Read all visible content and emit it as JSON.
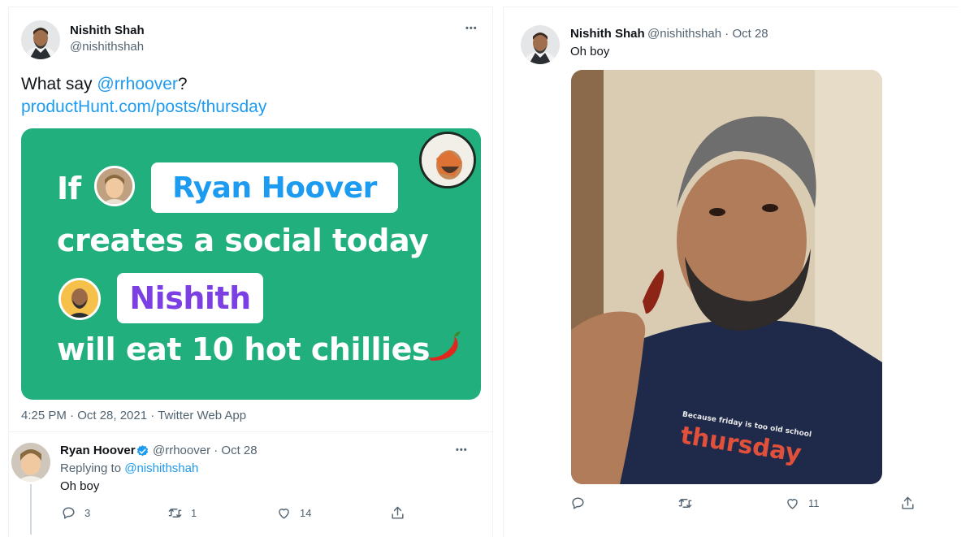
{
  "main_tweet": {
    "author_name": "Nishith Shah",
    "author_handle": "@nishithshah",
    "more": "•••",
    "text_prefix": "What say ",
    "mention": "@rrhoover",
    "text_suffix": "?",
    "link": "productHunt.com/posts/thursday",
    "card": {
      "line1_prefix": "If",
      "pill1": "Ryan Hoover",
      "line2": "creates a social today",
      "pill2": "Nishith",
      "line3": "will eat 10 hot chillies",
      "pill1_color": "#1d9bf0",
      "pill2_color": "#7b3fe4",
      "bg_color": "#21b07d"
    },
    "meta": "4:25 PM · Oct 28, 2021 · Twitter Web App"
  },
  "reply": {
    "author_name": "Ryan Hoover",
    "author_handle": "@rrhoover · Oct 28",
    "verified_icon": "verified-badge-icon",
    "replying_label": "Replying to ",
    "replying_handle": "@nishithshah",
    "text": "Oh boy",
    "more": "•••",
    "actions": {
      "reply_count": "3",
      "retweet_count": "1",
      "like_count": "14"
    }
  },
  "right_tweet": {
    "author_name": "Nishith Shah",
    "author_handle": "@nishithshah · Oct 28",
    "text": "Oh boy",
    "shirt_small": "Because friday is too old school",
    "shirt_big": "thursday",
    "actions": {
      "reply_count": "",
      "retweet_count": "",
      "like_count": "11"
    }
  },
  "colors": {
    "link": "#1d9bf0",
    "secondary_text": "#536471",
    "brand_green": "#21b07d"
  }
}
